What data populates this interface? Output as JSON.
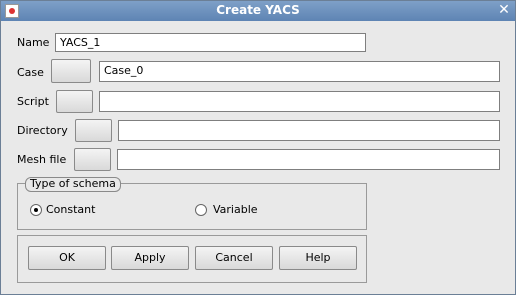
{
  "window": {
    "title": "Create YACS"
  },
  "fields": {
    "name": {
      "label": "Name",
      "value": "YACS_1"
    },
    "case": {
      "label": "Case",
      "value": "Case_0"
    },
    "script": {
      "label": "Script",
      "value": ""
    },
    "directory": {
      "label": "Directory",
      "value": ""
    },
    "mesh_file": {
      "label": "Mesh file",
      "value": ""
    }
  },
  "schema": {
    "title": "Type of schema",
    "options": [
      {
        "label": "Constant",
        "selected": true
      },
      {
        "label": "Variable",
        "selected": false
      }
    ]
  },
  "buttons": {
    "ok": "OK",
    "apply": "Apply",
    "cancel": "Cancel",
    "help": "Help"
  }
}
